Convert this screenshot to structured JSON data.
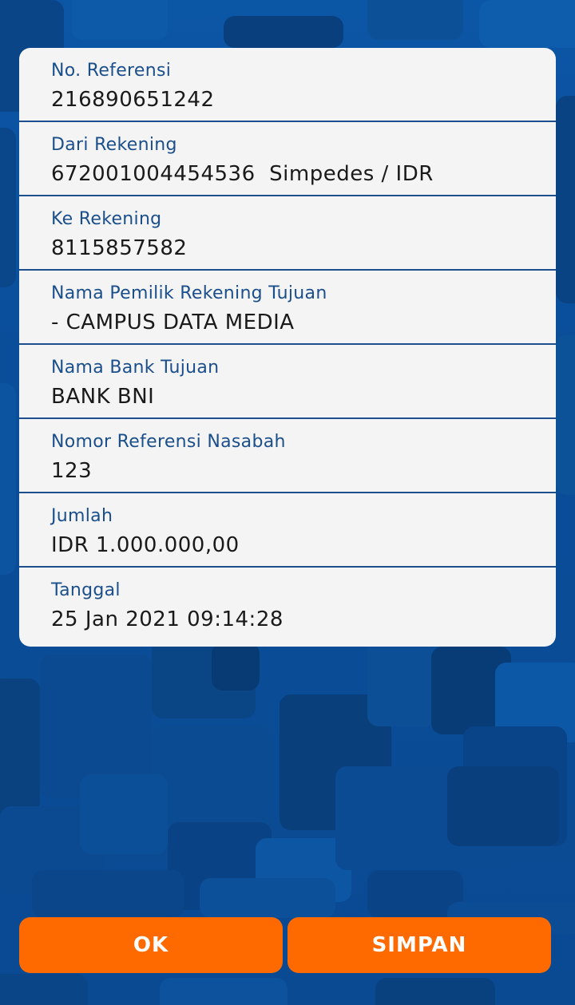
{
  "details": [
    {
      "label": "No. Referensi",
      "value": "216890651242"
    },
    {
      "label": "Dari Rekening",
      "value": "672001004454536  Simpedes / IDR"
    },
    {
      "label": "Ke Rekening",
      "value": "8115857582"
    },
    {
      "label": "Nama Pemilik Rekening Tujuan",
      "value": "- CAMPUS DATA MEDIA"
    },
    {
      "label": "Nama Bank Tujuan",
      "value": "BANK BNI"
    },
    {
      "label": "Nomor Referensi Nasabah",
      "value": "123"
    },
    {
      "label": "Jumlah",
      "value": "IDR 1.000.000,00"
    },
    {
      "label": "Tanggal",
      "value": "25 Jan 2021 09:14:28"
    }
  ],
  "buttons": {
    "ok_label": "OK",
    "save_label": "SIMPAN"
  },
  "colors": {
    "background": "#0b4f9a",
    "card": "#f4f4f4",
    "label": "#1b4f8c",
    "button": "#ff6a00"
  }
}
